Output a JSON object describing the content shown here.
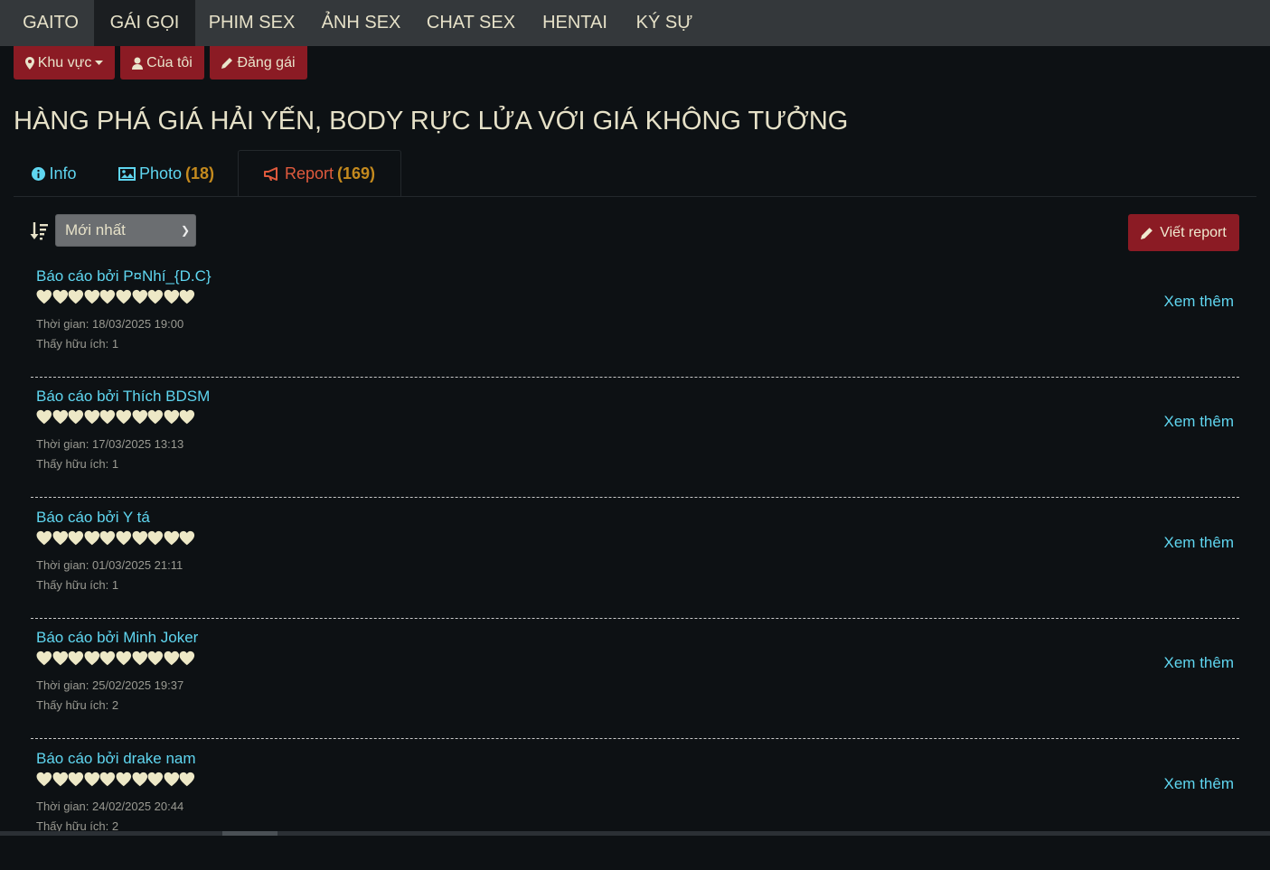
{
  "nav": {
    "items": [
      {
        "label": "GAITO"
      },
      {
        "label": "GÁI GỌI",
        "active": true
      },
      {
        "label": "PHIM SEX"
      },
      {
        "label": "ẢNH SEX"
      },
      {
        "label": "CHAT SEX"
      },
      {
        "label": "HENTAI"
      },
      {
        "label": "KÝ SỰ"
      }
    ]
  },
  "actions": {
    "area_label": "Khu vực",
    "mine_label": "Của tôi",
    "post_label": "Đăng gái"
  },
  "page_title": "HÀNG PHÁ GIÁ HẢI YẾN, BODY RỰC LỬA VỚI GIÁ KHÔNG TƯỞNG",
  "tabs": [
    {
      "label": "Info",
      "icon": "info-circle-icon"
    },
    {
      "label": "Photo",
      "count": "(18)",
      "icon": "image-icon"
    },
    {
      "label": "Report",
      "count": "(169)",
      "icon": "megaphone-icon",
      "active": true
    }
  ],
  "sort": {
    "selected": "Mới nhất"
  },
  "write_report_label": "Viết report",
  "colors": {
    "accent_red": "#8b1b24",
    "link": "#5fd6f0",
    "count": "#c48a1e",
    "heart": "#ede8c6"
  },
  "reports": [
    {
      "author": "Báo cáo bởi P¤Nhí_{D.C}",
      "rating": 10,
      "time": "Thời gian: 18/03/2025 19:00",
      "helpful": "Thấy hữu ích: 1",
      "more": "Xem thêm"
    },
    {
      "author": "Báo cáo bởi Thích BDSM",
      "rating": 10,
      "time": "Thời gian: 17/03/2025 13:13",
      "helpful": "Thấy hữu ích: 1",
      "more": "Xem thêm"
    },
    {
      "author": "Báo cáo bởi Y tá",
      "rating": 10,
      "time": "Thời gian: 01/03/2025 21:11",
      "helpful": "Thấy hữu ích: 1",
      "more": "Xem thêm"
    },
    {
      "author": "Báo cáo bởi Minh Joker",
      "rating": 10,
      "time": "Thời gian: 25/02/2025 19:37",
      "helpful": "Thấy hữu ích: 2",
      "more": "Xem thêm"
    },
    {
      "author": "Báo cáo bởi drake nam",
      "rating": 10,
      "time": "Thời gian: 24/02/2025 20:44",
      "helpful": "Thấy hữu ích: 2",
      "more": "Xem thêm"
    }
  ]
}
